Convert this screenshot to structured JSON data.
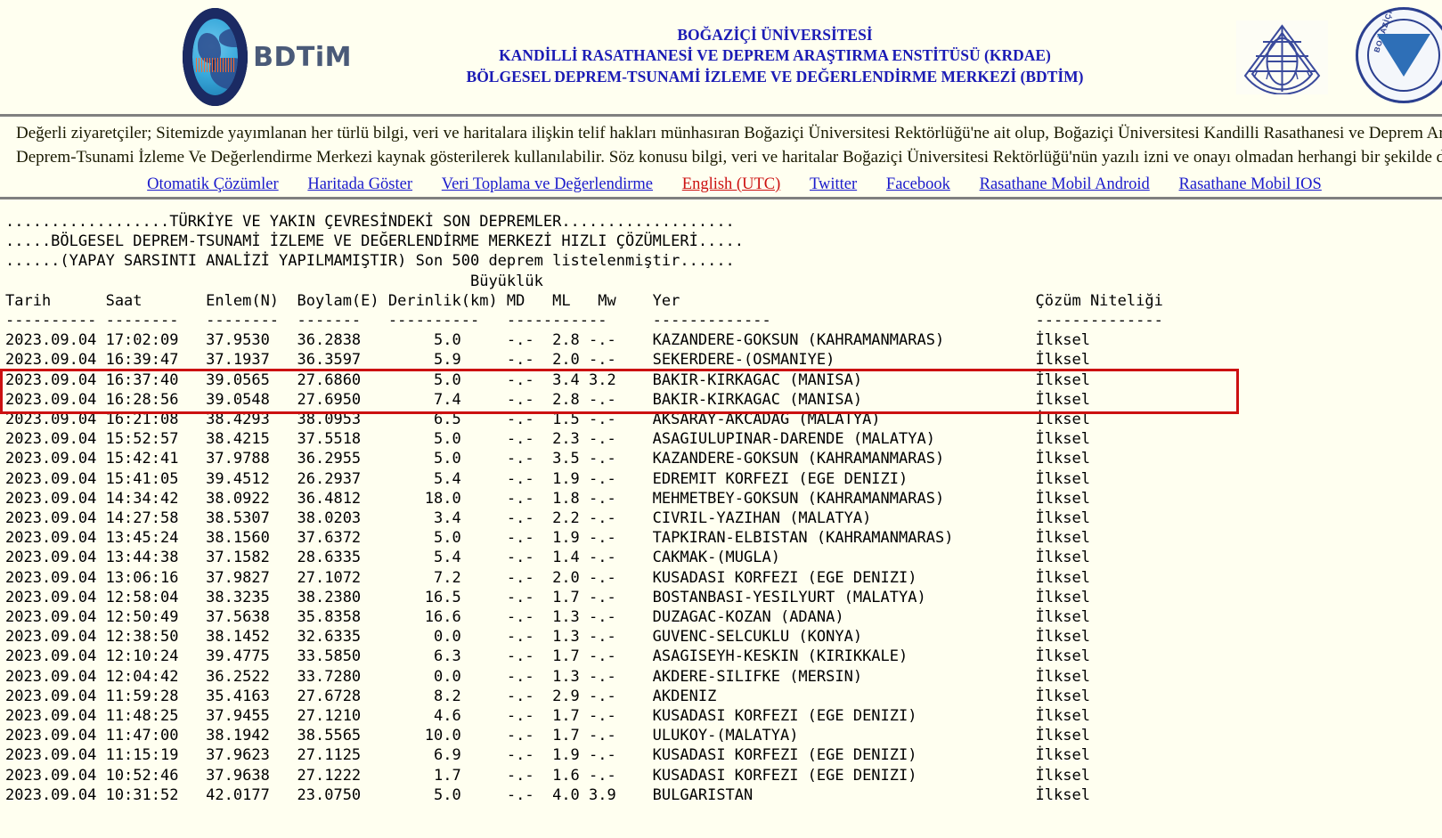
{
  "page": {
    "background_color": "#fffff0",
    "link_color": "#1a1acc",
    "active_link_color": "#cc1111",
    "title_color": "#1b1bb5",
    "highlight_color": "#cc1111"
  },
  "header": {
    "logo_text": "BDTiM",
    "logo_name": "bdtim-logo",
    "right_logo_1": "krdae-seal-logo",
    "right_logo_2": "bogazici-university-logo",
    "title_line_1": "BOĞAZİÇİ ÜNİVERSİTESİ",
    "title_line_2": "KANDİLLİ RASATHANESİ VE DEPREM ARAŞTIRMA ENSTİTÜSÜ (KRDAE)",
    "title_line_3": "BÖLGESEL DEPREM-TSUNAMİ İZLEME VE DEĞERLENDİRME MERKEZİ (BDTİM)"
  },
  "notice": {
    "line_1": "Değerli ziyaretçiler; Sitemizde yayımlanan her türlü bilgi, veri ve haritalara ilişkin telif hakları münhasıran Boğaziçi Üniversitesi Rektörlüğü'ne ait olup, Boğaziçi Üniversitesi Kandilli Rasathanesi ve Deprem Araştırma Enstitüsü Bölgesel",
    "line_2": "Deprem-Tsunami İzleme Ve Değerlendirme Merkezi kaynak gösterilerek kullanılabilir. Söz konusu bilgi, veri ve haritalar Boğaziçi Üniversitesi Rektörlüğü'nün yazılı izni ve onayı olmadan herhangi bir şekilde değiştirilemez."
  },
  "nav": {
    "links": [
      {
        "label": "Otomatik Çözümler",
        "active": false
      },
      {
        "label": "Haritada Göster",
        "active": false
      },
      {
        "label": "Veri Toplama ve Değerlendirme",
        "active": false
      },
      {
        "label": "English (UTC)",
        "active": true
      },
      {
        "label": "Twitter",
        "active": false
      },
      {
        "label": "Facebook",
        "active": false
      },
      {
        "label": "Rasathane Mobil Android",
        "active": false
      },
      {
        "label": "Rasathane Mobil IOS",
        "active": false
      }
    ]
  },
  "listing": {
    "banner_1": "..................TÜRKİYE VE YAKIN ÇEVRESİNDEKİ SON DEPREMLER...................",
    "banner_2": ".....BÖLGESEL DEPREM-TSUNAMİ İZLEME VE DEĞERLENDİRME MERKEZİ HIZLI ÇÖZÜMLERİ.....",
    "banner_3": "......(YAPAY SARSINTI ANALİZİ YAPILMAMIŞTIR) Son 500 deprem listelenmiştir......",
    "magnitude_group_header": "Büyüklük",
    "columns": [
      "Tarih",
      "Saat",
      "Enlem(N)",
      "Boylam(E)",
      "Derinlik(km)",
      "MD",
      "ML",
      "Mw",
      "Yer",
      "Çözüm Niteliği"
    ],
    "separator_row": "---------- -------- -------- ------- ---------- ----------- ------------- --------------",
    "highlighted_row_indices": [
      2,
      3
    ],
    "rows": [
      {
        "tarih": "2023.09.04",
        "saat": "17:02:09",
        "enlem": "37.9530",
        "boylam": "36.2838",
        "derinlik": "5.0",
        "md": "-.-",
        "ml": "2.8",
        "mw": "-.-",
        "yer": "KAZANDERE-GOKSUN (KAHRAMANMARAS)",
        "nitelik": "İlksel"
      },
      {
        "tarih": "2023.09.04",
        "saat": "16:39:47",
        "enlem": "37.1937",
        "boylam": "36.3597",
        "derinlik": "5.9",
        "md": "-.-",
        "ml": "2.0",
        "mw": "-.-",
        "yer": "SEKERDERE-(OSMANIYE)",
        "nitelik": "İlksel"
      },
      {
        "tarih": "2023.09.04",
        "saat": "16:37:40",
        "enlem": "39.0565",
        "boylam": "27.6860",
        "derinlik": "5.0",
        "md": "-.-",
        "ml": "3.4",
        "mw": "3.2",
        "yer": "BAKIR-KIRKAGAC (MANISA)",
        "nitelik": "İlksel"
      },
      {
        "tarih": "2023.09.04",
        "saat": "16:28:56",
        "enlem": "39.0548",
        "boylam": "27.6950",
        "derinlik": "7.4",
        "md": "-.-",
        "ml": "2.8",
        "mw": "-.-",
        "yer": "BAKIR-KIRKAGAC (MANISA)",
        "nitelik": "İlksel"
      },
      {
        "tarih": "2023.09.04",
        "saat": "16:21:08",
        "enlem": "38.4293",
        "boylam": "38.0953",
        "derinlik": "6.5",
        "md": "-.-",
        "ml": "1.5",
        "mw": "-.-",
        "yer": "AKSARAY-AKCADAG (MALATYA)",
        "nitelik": "İlksel"
      },
      {
        "tarih": "2023.09.04",
        "saat": "15:52:57",
        "enlem": "38.4215",
        "boylam": "37.5518",
        "derinlik": "5.0",
        "md": "-.-",
        "ml": "2.3",
        "mw": "-.-",
        "yer": "ASAGIULUPINAR-DARENDE (MALATYA)",
        "nitelik": "İlksel"
      },
      {
        "tarih": "2023.09.04",
        "saat": "15:42:41",
        "enlem": "37.9788",
        "boylam": "36.2955",
        "derinlik": "5.0",
        "md": "-.-",
        "ml": "3.5",
        "mw": "-.-",
        "yer": "KAZANDERE-GOKSUN (KAHRAMANMARAS)",
        "nitelik": "İlksel"
      },
      {
        "tarih": "2023.09.04",
        "saat": "15:41:05",
        "enlem": "39.4512",
        "boylam": "26.2937",
        "derinlik": "5.4",
        "md": "-.-",
        "ml": "1.9",
        "mw": "-.-",
        "yer": "EDREMIT KORFEZI (EGE DENIZI)",
        "nitelik": "İlksel"
      },
      {
        "tarih": "2023.09.04",
        "saat": "14:34:42",
        "enlem": "38.0922",
        "boylam": "36.4812",
        "derinlik": "18.0",
        "md": "-.-",
        "ml": "1.8",
        "mw": "-.-",
        "yer": "MEHMETBEY-GOKSUN (KAHRAMANMARAS)",
        "nitelik": "İlksel"
      },
      {
        "tarih": "2023.09.04",
        "saat": "14:27:58",
        "enlem": "38.5307",
        "boylam": "38.0203",
        "derinlik": "3.4",
        "md": "-.-",
        "ml": "2.2",
        "mw": "-.-",
        "yer": "CIVRIL-YAZIHAN (MALATYA)",
        "nitelik": "İlksel"
      },
      {
        "tarih": "2023.09.04",
        "saat": "13:45:24",
        "enlem": "38.1560",
        "boylam": "37.6372",
        "derinlik": "5.0",
        "md": "-.-",
        "ml": "1.9",
        "mw": "-.-",
        "yer": "TAPKIRAN-ELBISTAN (KAHRAMANMARAS)",
        "nitelik": "İlksel"
      },
      {
        "tarih": "2023.09.04",
        "saat": "13:44:38",
        "enlem": "37.1582",
        "boylam": "28.6335",
        "derinlik": "5.4",
        "md": "-.-",
        "ml": "1.4",
        "mw": "-.-",
        "yer": "CAKMAK-(MUGLA)",
        "nitelik": "İlksel"
      },
      {
        "tarih": "2023.09.04",
        "saat": "13:06:16",
        "enlem": "37.9827",
        "boylam": "27.1072",
        "derinlik": "7.2",
        "md": "-.-",
        "ml": "2.0",
        "mw": "-.-",
        "yer": "KUSADASI KORFEZI (EGE DENIZI)",
        "nitelik": "İlksel"
      },
      {
        "tarih": "2023.09.04",
        "saat": "12:58:04",
        "enlem": "38.3235",
        "boylam": "38.2380",
        "derinlik": "16.5",
        "md": "-.-",
        "ml": "1.7",
        "mw": "-.-",
        "yer": "BOSTANBASI-YESILYURT (MALATYA)",
        "nitelik": "İlksel"
      },
      {
        "tarih": "2023.09.04",
        "saat": "12:50:49",
        "enlem": "37.5638",
        "boylam": "35.8358",
        "derinlik": "16.6",
        "md": "-.-",
        "ml": "1.3",
        "mw": "-.-",
        "yer": "DUZAGAC-KOZAN (ADANA)",
        "nitelik": "İlksel"
      },
      {
        "tarih": "2023.09.04",
        "saat": "12:38:50",
        "enlem": "38.1452",
        "boylam": "32.6335",
        "derinlik": "0.0",
        "md": "-.-",
        "ml": "1.3",
        "mw": "-.-",
        "yer": "GUVENC-SELCUKLU (KONYA)",
        "nitelik": "İlksel"
      },
      {
        "tarih": "2023.09.04",
        "saat": "12:10:24",
        "enlem": "39.4775",
        "boylam": "33.5850",
        "derinlik": "6.3",
        "md": "-.-",
        "ml": "1.7",
        "mw": "-.-",
        "yer": "ASAGISEYH-KESKIN (KIRIKKALE)",
        "nitelik": "İlksel"
      },
      {
        "tarih": "2023.09.04",
        "saat": "12:04:42",
        "enlem": "36.2522",
        "boylam": "33.7280",
        "derinlik": "0.0",
        "md": "-.-",
        "ml": "1.3",
        "mw": "-.-",
        "yer": "AKDERE-SILIFKE (MERSIN)",
        "nitelik": "İlksel"
      },
      {
        "tarih": "2023.09.04",
        "saat": "11:59:28",
        "enlem": "35.4163",
        "boylam": "27.6728",
        "derinlik": "8.2",
        "md": "-.-",
        "ml": "2.9",
        "mw": "-.-",
        "yer": "AKDENIZ",
        "nitelik": "İlksel"
      },
      {
        "tarih": "2023.09.04",
        "saat": "11:48:25",
        "enlem": "37.9455",
        "boylam": "27.1210",
        "derinlik": "4.6",
        "md": "-.-",
        "ml": "1.7",
        "mw": "-.-",
        "yer": "KUSADASI KORFEZI (EGE DENIZI)",
        "nitelik": "İlksel"
      },
      {
        "tarih": "2023.09.04",
        "saat": "11:47:00",
        "enlem": "38.1942",
        "boylam": "38.5565",
        "derinlik": "10.0",
        "md": "-.-",
        "ml": "1.7",
        "mw": "-.-",
        "yer": "ULUKOY-(MALATYA)",
        "nitelik": "İlksel"
      },
      {
        "tarih": "2023.09.04",
        "saat": "11:15:19",
        "enlem": "37.9623",
        "boylam": "27.1125",
        "derinlik": "6.9",
        "md": "-.-",
        "ml": "1.9",
        "mw": "-.-",
        "yer": "KUSADASI KORFEZI (EGE DENIZI)",
        "nitelik": "İlksel"
      },
      {
        "tarih": "2023.09.04",
        "saat": "10:52:46",
        "enlem": "37.9638",
        "boylam": "27.1222",
        "derinlik": "1.7",
        "md": "-.-",
        "ml": "1.6",
        "mw": "-.-",
        "yer": "KUSADASI KORFEZI (EGE DENIZI)",
        "nitelik": "İlksel"
      },
      {
        "tarih": "2023.09.04",
        "saat": "10:31:52",
        "enlem": "42.0177",
        "boylam": "23.0750",
        "derinlik": "5.0",
        "md": "-.-",
        "ml": "4.0",
        "mw": "3.9",
        "yer": "BULGARISTAN",
        "nitelik": "İlksel"
      }
    ]
  }
}
